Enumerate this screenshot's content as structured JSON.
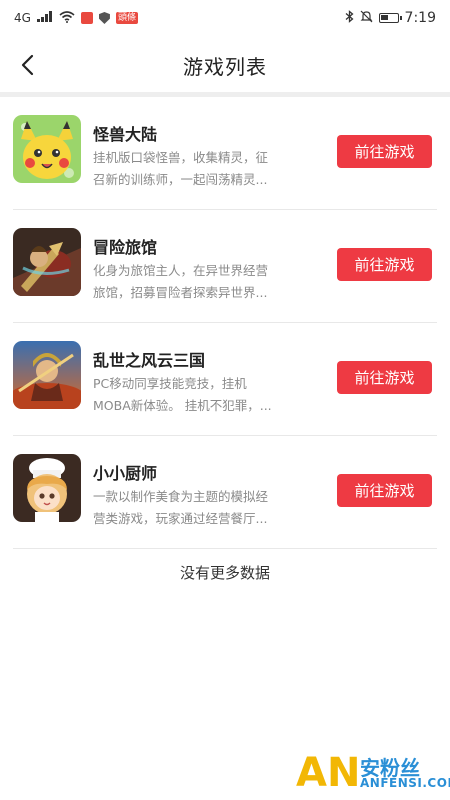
{
  "status_bar": {
    "left_text": "4G",
    "notification_badge": "頭條",
    "battery_level": 0.5,
    "time": "7:19"
  },
  "header": {
    "title": "游戏列表",
    "back_icon": "chevron-left-icon"
  },
  "games": [
    {
      "title": "怪兽大陆",
      "description": "挂机版口袋怪兽，收集精灵，征召新的训练师，一起闯荡精灵...",
      "button_label": "前往游戏"
    },
    {
      "title": "冒险旅馆",
      "description": "化身为旅馆主人，在异世界经营旅馆，招募冒险者探索异世界...",
      "button_label": "前往游戏"
    },
    {
      "title": "乱世之风云三国",
      "description": "PC移动同享技能竞技，挂机MOBA新体验。 挂机不犯罪，...",
      "button_label": "前往游戏"
    },
    {
      "title": "小小厨师",
      "description": "一款以制作美食为主题的模拟经营类游戏，玩家通过经营餐厅...",
      "button_label": "前往游戏"
    }
  ],
  "footer_text": "没有更多数据",
  "watermark": {
    "logo": "AN",
    "cn": "安粉丝",
    "en": "ANFENSI.COM"
  },
  "colors": {
    "accent": "#ee3a43",
    "watermark_yellow": "#f2b705",
    "watermark_blue": "#2a8fd6"
  }
}
